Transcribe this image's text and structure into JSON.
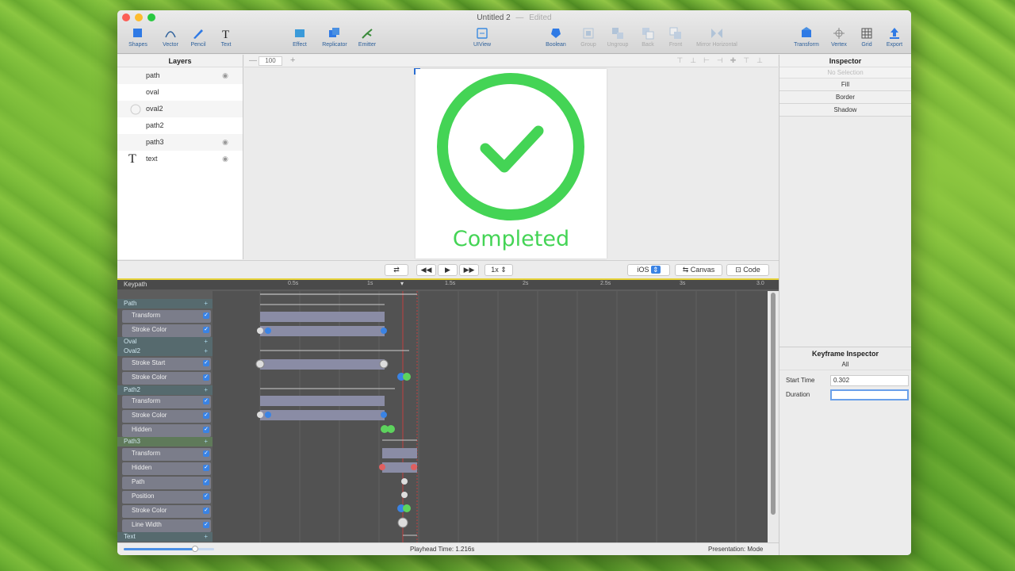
{
  "window": {
    "title": "Untitled 2",
    "status": "Edited"
  },
  "toolbar": {
    "items": [
      {
        "label": "Shapes",
        "icon": "shapes-icon"
      },
      {
        "label": "Vector",
        "icon": "vector-icon"
      },
      {
        "label": "Pencil",
        "icon": "pencil-icon"
      },
      {
        "label": "Text",
        "icon": "text-icon"
      },
      {
        "label": "Effect",
        "icon": "effect-icon"
      },
      {
        "label": "Replicator",
        "icon": "replicator-icon"
      },
      {
        "label": "Emitter",
        "icon": "emitter-icon"
      },
      {
        "label": "UIView",
        "icon": "uiview-icon"
      },
      {
        "label": "Boolean",
        "icon": "boolean-icon"
      },
      {
        "label": "Group",
        "icon": "group-icon"
      },
      {
        "label": "Ungroup",
        "icon": "ungroup-icon"
      },
      {
        "label": "Back",
        "icon": "back-icon"
      },
      {
        "label": "Front",
        "icon": "front-icon"
      },
      {
        "label": "Mirror Horizontal",
        "icon": "mirror-horizontal-icon"
      },
      {
        "label": "Transform",
        "icon": "transform-icon"
      },
      {
        "label": "Vertex",
        "icon": "vertex-icon"
      },
      {
        "label": "Grid",
        "icon": "grid-icon"
      },
      {
        "label": "Export",
        "icon": "export-icon"
      }
    ]
  },
  "layers": {
    "title": "Layers",
    "items": [
      {
        "name": "path",
        "visible": true
      },
      {
        "name": "oval",
        "visible": false
      },
      {
        "name": "oval2",
        "visible": false
      },
      {
        "name": "path2",
        "visible": false
      },
      {
        "name": "path3",
        "visible": true
      },
      {
        "name": "text",
        "visible": true
      }
    ]
  },
  "canvas": {
    "zoom": "100",
    "artboard_text": "Completed",
    "accent_color": "#44d455"
  },
  "inspector": {
    "title": "Inspector",
    "no_selection": "No Selection",
    "sections": [
      "Fill",
      "Border",
      "Shadow"
    ]
  },
  "playback": {
    "speed": "1x",
    "platform": "iOS",
    "canvas_label": "Canvas",
    "code_label": "Code"
  },
  "keyframe_inspector": {
    "title": "Keyframe Inspector",
    "scope": "All",
    "start_time_label": "Start Time",
    "start_time_value": "0.302",
    "duration_label": "Duration",
    "duration_value": ""
  },
  "timeline": {
    "header": "Keypath",
    "ticks": [
      "0.5s",
      "1s",
      "1.5s",
      "2s",
      "2.5s",
      "3s",
      "3.0"
    ],
    "rows": [
      {
        "label": "Path",
        "kind": "group"
      },
      {
        "label": "Transform",
        "kind": "prop"
      },
      {
        "label": "Stroke Color",
        "kind": "prop"
      },
      {
        "label": "Oval",
        "kind": "group"
      },
      {
        "label": "Oval2",
        "kind": "group"
      },
      {
        "label": "Stroke Start",
        "kind": "prop"
      },
      {
        "label": "Stroke Color",
        "kind": "prop"
      },
      {
        "label": "Path2",
        "kind": "group"
      },
      {
        "label": "Transform",
        "kind": "prop"
      },
      {
        "label": "Stroke Color",
        "kind": "prop"
      },
      {
        "label": "Hidden",
        "kind": "prop"
      },
      {
        "label": "Path3",
        "kind": "group"
      },
      {
        "label": "Transform",
        "kind": "prop"
      },
      {
        "label": "Hidden",
        "kind": "prop"
      },
      {
        "label": "Path",
        "kind": "prop"
      },
      {
        "label": "Position",
        "kind": "prop"
      },
      {
        "label": "Stroke Color",
        "kind": "prop"
      },
      {
        "label": "Line Width",
        "kind": "prop"
      },
      {
        "label": "Text",
        "kind": "group"
      }
    ]
  },
  "status": {
    "playhead": "Playhead Time: 1.216s",
    "mode": "Presentation: Mode"
  }
}
